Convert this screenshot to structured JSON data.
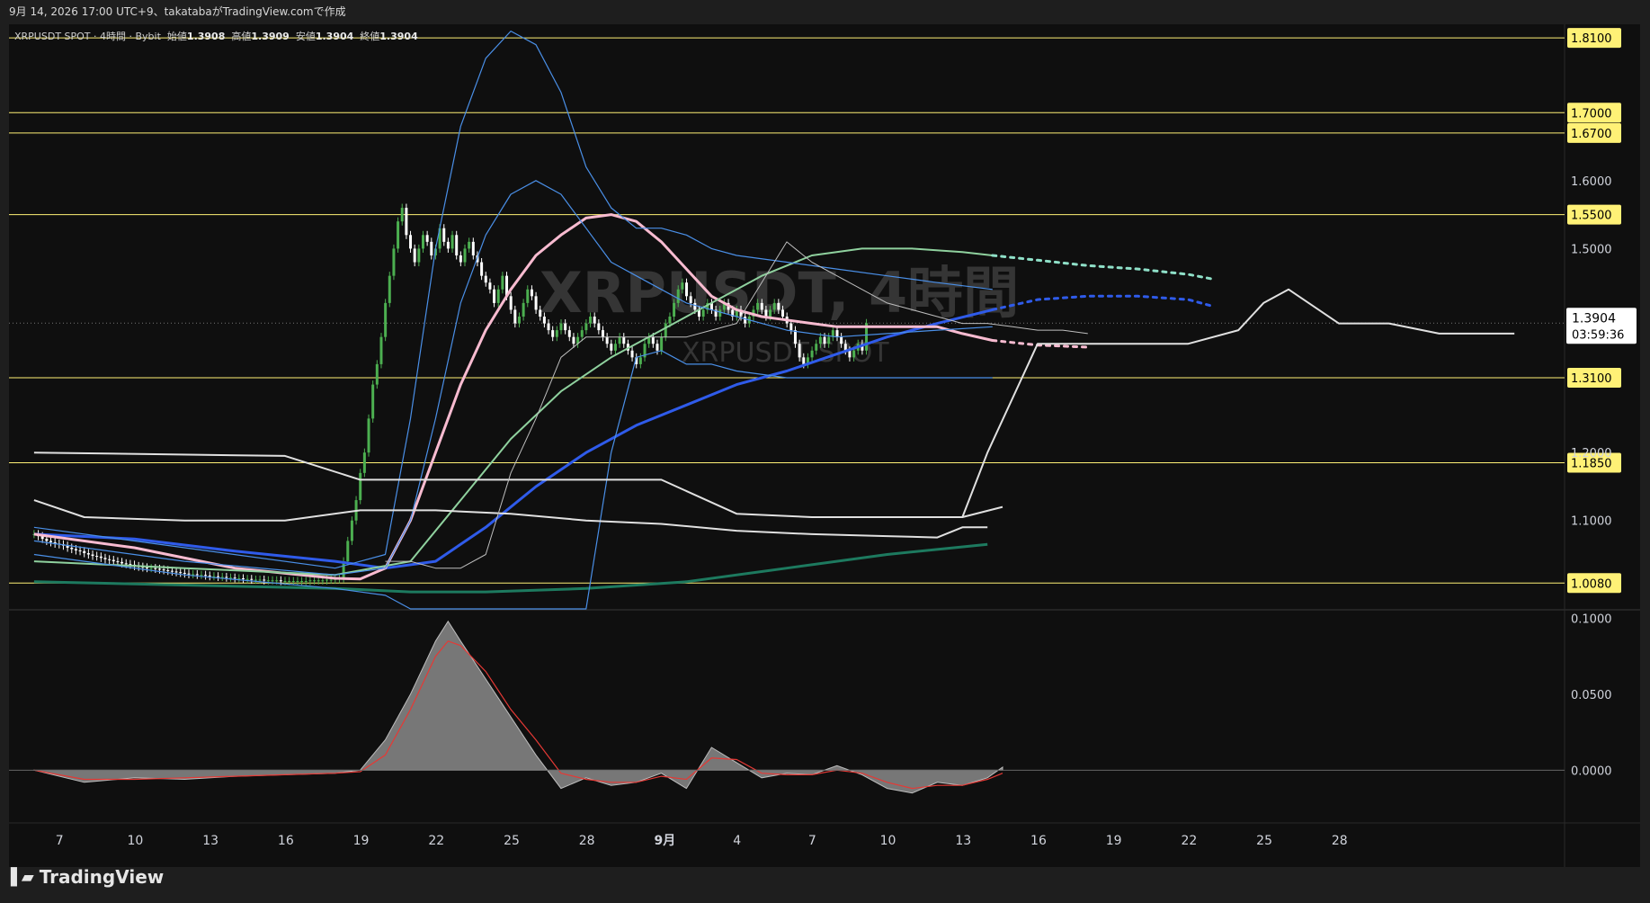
{
  "header": {
    "caption": "9月 14, 2026 17:00 UTC+9、takatabaがTradingView.comで作成"
  },
  "legend": {
    "symbol": "XRPUSDT SPOT · 4時間 · Bybit",
    "open_label": "始値",
    "open": "1.3908",
    "high_label": "高値",
    "high": "1.3909",
    "low_label": "安値",
    "low": "1.3904",
    "close_label": "終値",
    "close": "1.3904"
  },
  "watermark": {
    "line1": "XRPUSDT, 4時間",
    "line2": "XRPUSDT SPOT"
  },
  "price_box": {
    "price": "1.3904",
    "countdown": "03:59:36"
  },
  "footer": {
    "brand": "TradingView"
  },
  "colors": {
    "background": "#0f0f0f",
    "level_line": "#fff176",
    "candle_up": "#4caf50",
    "candle_down": "#ffffff",
    "ma_blue": "#2f5bea",
    "ma_pink": "#f8bbd0",
    "ma_teal": "#1d7a5f",
    "ma_light_green": "#8fd19e",
    "band_blue": "#4a8fe7",
    "ichimoku_white": "#e0e0e0",
    "osc_fill": "#8a8a8a",
    "osc_signal": "#e53935"
  },
  "chart_data": [
    {
      "type": "line",
      "panel": "price",
      "title": "",
      "x_ticks": [
        "7",
        "10",
        "13",
        "16",
        "19",
        "22",
        "25",
        "28",
        "9月",
        "4",
        "7",
        "10",
        "13",
        "16",
        "19",
        "22",
        "25",
        "28"
      ],
      "y_ticks": [
        "1.1000",
        "1.2000",
        "1.5000",
        "1.6000"
      ],
      "ylim": [
        0.97,
        1.83
      ],
      "horizontal_levels": [
        {
          "value": 1.81,
          "label": "1.8100"
        },
        {
          "value": 1.7,
          "label": "1.7000"
        },
        {
          "value": 1.67,
          "label": "1.6700"
        },
        {
          "value": 1.55,
          "label": "1.5500"
        },
        {
          "value": 1.31,
          "label": "1.3100"
        },
        {
          "value": 1.185,
          "label": "1.1850"
        },
        {
          "value": 1.008,
          "label": "1.0080"
        }
      ],
      "last_price": 1.3904,
      "candles": {
        "x_start_day": 6.0,
        "step_days": 0.1667,
        "close": [
          1.08,
          1.077,
          1.073,
          1.07,
          1.068,
          1.066,
          1.065,
          1.063,
          1.06,
          1.058,
          1.056,
          1.055,
          1.052,
          1.05,
          1.048,
          1.047,
          1.045,
          1.043,
          1.042,
          1.04,
          1.039,
          1.037,
          1.036,
          1.035,
          1.033,
          1.032,
          1.031,
          1.03,
          1.03,
          1.029,
          1.028,
          1.027,
          1.026,
          1.025,
          1.024,
          1.023,
          1.022,
          1.021,
          1.021,
          1.02,
          1.02,
          1.019,
          1.018,
          1.018,
          1.017,
          1.017,
          1.016,
          1.016,
          1.015,
          1.015,
          1.014,
          1.014,
          1.013,
          1.013,
          1.013,
          1.012,
          1.012,
          1.012,
          1.012,
          1.011,
          1.011,
          1.011,
          1.011,
          1.011,
          1.011,
          1.011,
          1.012,
          1.012,
          1.012,
          1.012,
          1.013,
          1.013,
          1.014,
          1.015,
          1.04,
          1.07,
          1.1,
          1.13,
          1.17,
          1.2,
          1.25,
          1.3,
          1.33,
          1.37,
          1.42,
          1.46,
          1.5,
          1.54,
          1.56,
          1.52,
          1.5,
          1.48,
          1.5,
          1.52,
          1.51,
          1.49,
          1.5,
          1.53,
          1.51,
          1.5,
          1.52,
          1.49,
          1.48,
          1.5,
          1.51,
          1.49,
          1.48,
          1.46,
          1.45,
          1.44,
          1.42,
          1.44,
          1.46,
          1.43,
          1.41,
          1.39,
          1.4,
          1.42,
          1.44,
          1.43,
          1.41,
          1.4,
          1.39,
          1.38,
          1.37,
          1.38,
          1.39,
          1.38,
          1.37,
          1.36,
          1.37,
          1.38,
          1.39,
          1.4,
          1.39,
          1.38,
          1.37,
          1.36,
          1.35,
          1.36,
          1.37,
          1.36,
          1.35,
          1.34,
          1.33,
          1.34,
          1.36,
          1.37,
          1.36,
          1.35,
          1.37,
          1.39,
          1.4,
          1.42,
          1.44,
          1.45,
          1.43,
          1.42,
          1.41,
          1.4,
          1.41,
          1.42,
          1.41,
          1.4,
          1.41,
          1.42,
          1.41,
          1.4,
          1.41,
          1.4,
          1.39,
          1.4,
          1.41,
          1.42,
          1.41,
          1.4,
          1.41,
          1.42,
          1.41,
          1.4,
          1.39,
          1.38,
          1.36,
          1.34,
          1.33,
          1.34,
          1.35,
          1.36,
          1.37,
          1.36,
          1.37,
          1.38,
          1.37,
          1.36,
          1.35,
          1.34,
          1.35,
          1.36,
          1.35,
          1.3904
        ]
      },
      "series": [
        {
          "color": "#2f5bea",
          "x_days": [
            6,
            10,
            14,
            18,
            20,
            22,
            24,
            26,
            28,
            30,
            32,
            34,
            36,
            38,
            40,
            42,
            44.2
          ],
          "values": [
            1.08,
            1.073,
            1.055,
            1.04,
            1.03,
            1.04,
            1.09,
            1.15,
            1.2,
            1.24,
            1.27,
            1.3,
            1.32,
            1.345,
            1.37,
            1.39,
            1.41
          ]
        },
        {
          "color": "#2f5bea",
          "dashed": true,
          "x_days": [
            44.2,
            46,
            48,
            50,
            52,
            53
          ],
          "values": [
            1.41,
            1.425,
            1.43,
            1.43,
            1.425,
            1.415
          ]
        },
        {
          "color": "#f8bbd0",
          "x_days": [
            6,
            10,
            14,
            18,
            19,
            20,
            21,
            22,
            23,
            24,
            25,
            26,
            27,
            28,
            29,
            30,
            31,
            32,
            33,
            34,
            35,
            36,
            37,
            38,
            39,
            40,
            41,
            42,
            43,
            44.2
          ],
          "values": [
            1.08,
            1.06,
            1.03,
            1.015,
            1.014,
            1.03,
            1.1,
            1.2,
            1.3,
            1.38,
            1.44,
            1.49,
            1.52,
            1.545,
            1.55,
            1.54,
            1.51,
            1.47,
            1.43,
            1.41,
            1.4,
            1.395,
            1.39,
            1.385,
            1.385,
            1.385,
            1.385,
            1.385,
            1.375,
            1.365
          ]
        },
        {
          "color": "#f8bbd0",
          "dashed": true,
          "x_days": [
            44.2,
            46,
            48
          ],
          "values": [
            1.365,
            1.358,
            1.355
          ]
        },
        {
          "color": "#1d7a5f",
          "x_days": [
            6,
            12,
            18,
            21,
            24,
            28,
            32,
            36,
            40,
            44
          ],
          "values": [
            1.01,
            1.005,
            1.0,
            0.995,
            0.995,
            1.0,
            1.01,
            1.03,
            1.05,
            1.065
          ]
        },
        {
          "color": "#8fd19e",
          "x_days": [
            6,
            12,
            18,
            21,
            23,
            25,
            27,
            29,
            31,
            33,
            35,
            37,
            39,
            41,
            43,
            44.2
          ],
          "values": [
            1.04,
            1.03,
            1.02,
            1.04,
            1.13,
            1.22,
            1.29,
            1.34,
            1.38,
            1.42,
            1.46,
            1.49,
            1.5,
            1.5,
            1.495,
            1.49
          ]
        },
        {
          "color": "#8fe0c8",
          "dashed": true,
          "x_days": [
            44.2,
            46,
            48,
            50,
            52,
            53
          ],
          "values": [
            1.49,
            1.483,
            1.475,
            1.47,
            1.462,
            1.455
          ]
        },
        {
          "color": "#4a8fe7",
          "x_days": [
            6,
            12,
            18,
            20,
            21,
            22,
            23,
            24,
            25,
            26,
            27,
            28,
            29,
            30,
            31,
            32,
            33,
            34,
            36,
            38,
            40,
            42,
            44.2
          ],
          "values": [
            1.07,
            1.04,
            1.02,
            1.03,
            1.1,
            1.25,
            1.42,
            1.52,
            1.58,
            1.6,
            1.58,
            1.53,
            1.48,
            1.46,
            1.44,
            1.42,
            1.41,
            1.4,
            1.38,
            1.37,
            1.375,
            1.38,
            1.385
          ]
        },
        {
          "color": "#4a8fe7",
          "x_days": [
            6,
            12,
            18,
            20,
            21,
            22,
            23,
            24,
            25,
            26,
            27,
            28,
            29,
            30,
            31,
            32,
            33,
            34,
            36,
            38,
            40,
            42,
            44.2
          ],
          "values": [
            1.09,
            1.06,
            1.03,
            1.05,
            1.25,
            1.5,
            1.68,
            1.78,
            1.82,
            1.8,
            1.73,
            1.62,
            1.56,
            1.53,
            1.53,
            1.52,
            1.5,
            1.49,
            1.48,
            1.47,
            1.46,
            1.45,
            1.44
          ]
        },
        {
          "color": "#4a8fe7",
          "x_days": [
            6,
            12,
            18,
            20,
            21,
            22,
            23,
            24,
            25,
            26,
            27,
            28,
            29,
            30,
            31,
            32,
            33,
            34,
            36,
            38,
            40,
            42,
            44.2
          ],
          "values": [
            1.05,
            1.02,
            1.0,
            0.99,
            0.97,
            0.97,
            0.97,
            0.97,
            0.97,
            0.97,
            0.97,
            0.97,
            1.2,
            1.34,
            1.35,
            1.33,
            1.33,
            1.32,
            1.31,
            1.31,
            1.31,
            1.31,
            1.31
          ]
        },
        {
          "color": "#e0e0e0",
          "x_days": [
            6,
            16,
            19,
            22,
            25,
            28,
            31,
            34,
            37,
            40,
            43,
            44.6
          ],
          "values": [
            1.2,
            1.195,
            1.16,
            1.16,
            1.16,
            1.16,
            1.16,
            1.11,
            1.105,
            1.105,
            1.105,
            1.12
          ]
        },
        {
          "color": "#e0e0e0",
          "x_days": [
            6,
            8,
            12,
            16,
            19,
            22,
            25,
            28,
            31,
            34,
            37,
            40,
            42,
            43,
            44
          ],
          "values": [
            1.13,
            1.105,
            1.1,
            1.1,
            1.115,
            1.115,
            1.11,
            1.1,
            1.095,
            1.085,
            1.08,
            1.077,
            1.075,
            1.09,
            1.09
          ]
        },
        {
          "color": "#e0e0e0",
          "x_days": [
            40,
            42,
            43,
            44,
            46,
            48,
            50,
            52,
            54,
            55,
            56,
            58,
            60,
            62,
            65
          ],
          "values": [
            1.105,
            1.105,
            1.105,
            1.2,
            1.36,
            1.36,
            1.36,
            1.36,
            1.38,
            1.42,
            1.44,
            1.39,
            1.39,
            1.375,
            1.375
          ]
        },
        {
          "color": "#bdbdbd",
          "x_days": [
            20,
            21,
            22,
            23,
            24,
            25,
            26,
            27,
            28,
            29,
            30,
            31,
            32,
            33,
            34,
            35,
            36,
            37,
            38,
            39,
            40,
            41,
            42,
            43,
            44,
            45,
            46,
            47,
            48
          ],
          "values": [
            1.04,
            1.04,
            1.03,
            1.03,
            1.05,
            1.17,
            1.25,
            1.34,
            1.37,
            1.37,
            1.37,
            1.37,
            1.37,
            1.38,
            1.39,
            1.45,
            1.51,
            1.48,
            1.46,
            1.44,
            1.42,
            1.41,
            1.4,
            1.39,
            1.39,
            1.385,
            1.38,
            1.38,
            1.375
          ]
        }
      ]
    },
    {
      "type": "area",
      "panel": "oscillator",
      "y_ticks": [
        "0.1000",
        "0.0500",
        "0.0000"
      ],
      "ylim": [
        -0.03,
        0.105
      ],
      "x_days": [
        6,
        8,
        10,
        12,
        14,
        16,
        18,
        19,
        20,
        21,
        22,
        22.5,
        23,
        24,
        25,
        26,
        27,
        28,
        29,
        30,
        31,
        32,
        33,
        34,
        35,
        36,
        37,
        38,
        39,
        40,
        41,
        42,
        43,
        44,
        44.6
      ],
      "values": [
        0,
        -0.008,
        -0.005,
        -0.006,
        -0.004,
        -0.003,
        -0.002,
        0.0,
        0.02,
        0.05,
        0.085,
        0.098,
        0.085,
        0.06,
        0.035,
        0.01,
        -0.012,
        -0.005,
        -0.01,
        -0.008,
        -0.002,
        -0.012,
        0.015,
        0.005,
        -0.005,
        -0.002,
        -0.003,
        0.003,
        -0.003,
        -0.012,
        -0.015,
        -0.008,
        -0.01,
        -0.005,
        0.002
      ],
      "signal": [
        0,
        -0.006,
        -0.006,
        -0.005,
        -0.004,
        -0.003,
        -0.002,
        -0.001,
        0.01,
        0.04,
        0.075,
        0.085,
        0.082,
        0.065,
        0.04,
        0.02,
        -0.002,
        -0.006,
        -0.008,
        -0.008,
        -0.004,
        -0.006,
        0.008,
        0.007,
        -0.002,
        -0.003,
        -0.003,
        0.0,
        -0.002,
        -0.008,
        -0.012,
        -0.01,
        -0.01,
        -0.006,
        -0.002
      ]
    }
  ]
}
